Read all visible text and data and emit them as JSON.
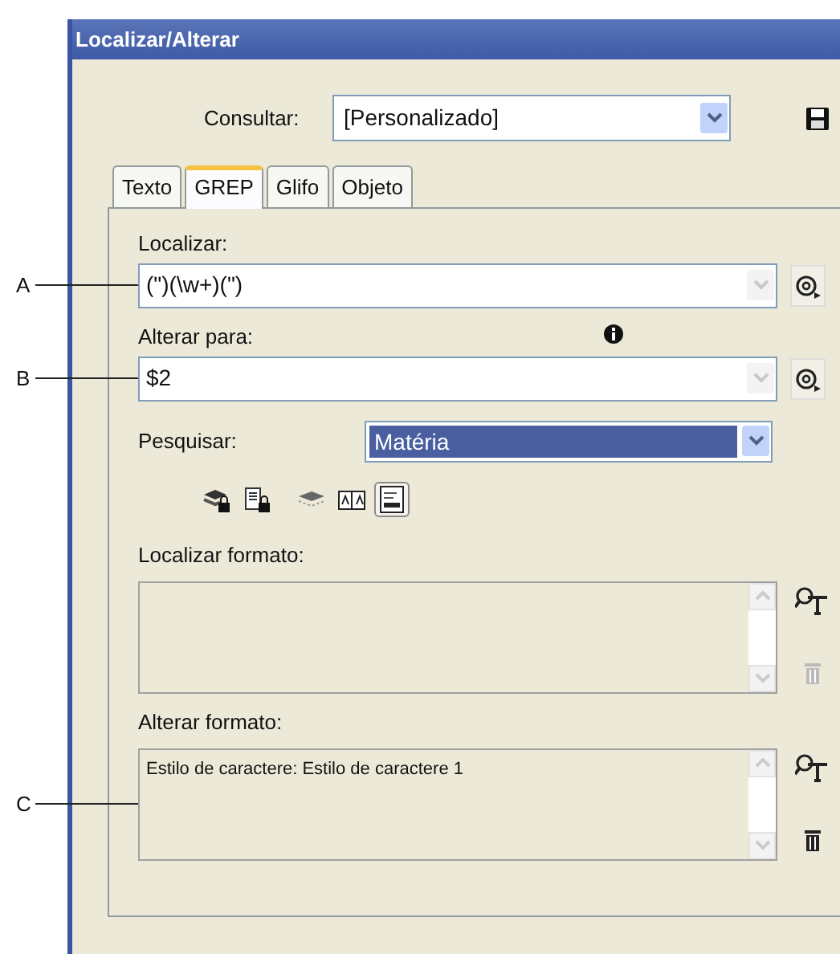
{
  "window": {
    "title": "Localizar/Alterar"
  },
  "query": {
    "label": "Consultar:",
    "value": "[Personalizado]"
  },
  "tabs": [
    {
      "label": "Texto",
      "selected": false
    },
    {
      "label": "GREP",
      "selected": true
    },
    {
      "label": "Glifo",
      "selected": false
    },
    {
      "label": "Objeto",
      "selected": false
    }
  ],
  "find": {
    "label": "Localizar:",
    "value": "(\")(\\w+)(\")",
    "callout": "A"
  },
  "change": {
    "label": "Alterar para:",
    "value": "$2",
    "callout": "B"
  },
  "search": {
    "label": "Pesquisar:",
    "value": "Matéria"
  },
  "scope_options": [
    {
      "kind": "stack-lock",
      "selected": false
    },
    {
      "kind": "page-lock",
      "selected": false
    },
    {
      "kind": "stack",
      "selected": false
    },
    {
      "kind": "book",
      "selected": false
    },
    {
      "kind": "panel",
      "selected": true
    }
  ],
  "find_format": {
    "label": "Localizar formato:"
  },
  "change_format": {
    "label": "Alterar formato:",
    "value": "Estilo de caractere: Estilo de caractere 1",
    "callout": "C"
  }
}
